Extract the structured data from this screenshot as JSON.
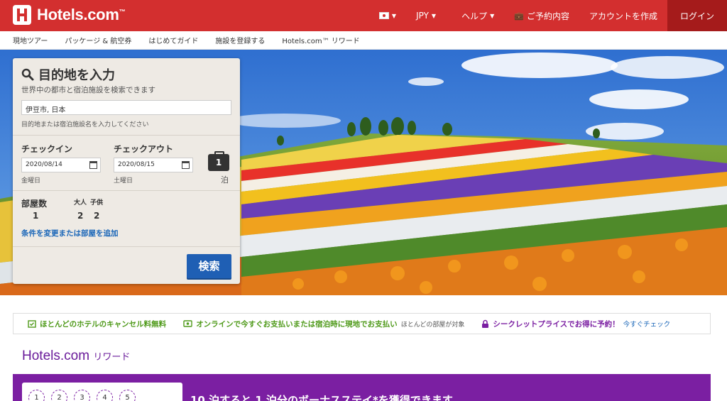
{
  "brand": {
    "name": "Hotels.com",
    "tm": "™"
  },
  "topnav": {
    "currency": "JPY",
    "help": "ヘルプ",
    "bookings": "ご予約内容",
    "create_account": "アカウントを作成",
    "login": "ログイン"
  },
  "subnav": {
    "items": [
      "現地ツアー",
      "パッケージ & 航空券",
      "はじめてガイド",
      "施設を登録する",
      "Hotels.com™ リワード"
    ]
  },
  "search": {
    "title": "目的地を入力",
    "subtitle": "世界中の都市と宿泊施設を検索できます",
    "destination_value": "伊豆市, 日本",
    "destination_hint": "目的地または宿泊施設名を入力してください",
    "checkin_label": "チェックイン",
    "checkout_label": "チェックアウト",
    "checkin_value": "2020/08/14",
    "checkout_value": "2020/08/15",
    "checkin_day": "金曜日",
    "checkout_day": "土曜日",
    "nights_count": "1",
    "nights_label": "泊",
    "rooms_label": "部屋数",
    "adults_label": "大人",
    "children_label": "子供",
    "rooms_value": "1",
    "adults_value": "2",
    "children_value": "2",
    "modify_link": "条件を変更または部屋を追加",
    "search_button": "検索"
  },
  "benefits": {
    "free_cancel": "ほとんどのホテルのキャンセル料無料",
    "pay_now_or_later": "オンラインで今すぐお支払いまたは宿泊時に現地でお支払い",
    "pay_note": "ほとんどの部屋が対象",
    "secret_price": "シークレットプライスでお得に予約！",
    "secret_link": "今すぐチェック"
  },
  "rewards": {
    "logo": "Hotels.com",
    "logo_suffix": "リワード",
    "stamps": [
      "1",
      "2",
      "3",
      "4",
      "5"
    ],
    "headline": "10 泊すると 1 泊分のボーナスステイ*を獲得できます"
  },
  "colors": {
    "brand_red": "#d32f2f",
    "login_bg": "#a51b1b",
    "search_blue": "#1f5fb4",
    "benefit_green": "#4f9a1a",
    "rewards_purple": "#7b1fa2"
  }
}
